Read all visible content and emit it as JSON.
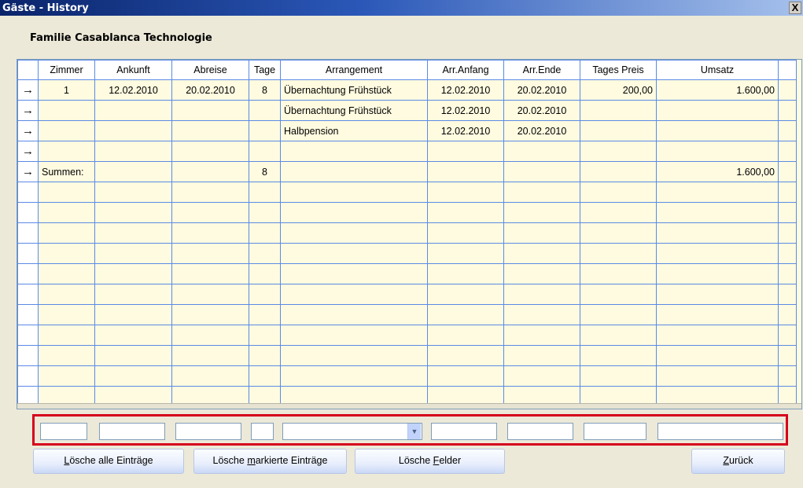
{
  "window": {
    "title": "Gäste - History",
    "close_label": "X"
  },
  "guest_name": "Familie Casablanca Technologie",
  "columns": [
    "Zimmer",
    "Ankunft",
    "Abreise",
    "Tage",
    "Arrangement",
    "Arr.Anfang",
    "Arr.Ende",
    "Tages Preis",
    "Umsatz"
  ],
  "row_marker": "→",
  "rows": [
    {
      "zimmer": "1",
      "ankunft": "12.02.2010",
      "abreise": "20.02.2010",
      "tage": "8",
      "arrangement": "Übernachtung Frühstück",
      "arr_anfang": "12.02.2010",
      "arr_ende": "20.02.2010",
      "tages_preis": "200,00",
      "umsatz": "1.600,00"
    },
    {
      "zimmer": "",
      "ankunft": "",
      "abreise": "",
      "tage": "",
      "arrangement": "Übernachtung Frühstück",
      "arr_anfang": "12.02.2010",
      "arr_ende": "20.02.2010",
      "tages_preis": "",
      "umsatz": ""
    },
    {
      "zimmer": "",
      "ankunft": "",
      "abreise": "",
      "tage": "",
      "arrangement": "Halbpension",
      "arr_anfang": "12.02.2010",
      "arr_ende": "20.02.2010",
      "tages_preis": "",
      "umsatz": ""
    },
    {
      "zimmer": "",
      "ankunft": "",
      "abreise": "",
      "tage": "",
      "arrangement": "",
      "arr_anfang": "",
      "arr_ende": "",
      "tages_preis": "",
      "umsatz": ""
    },
    {
      "zimmer": "Summen:",
      "ankunft": "",
      "abreise": "",
      "tage": "8",
      "arrangement": "",
      "arr_anfang": "",
      "arr_ende": "",
      "tages_preis": "",
      "umsatz": "1.600,00"
    }
  ],
  "filters": {
    "zimmer": "",
    "ankunft": "",
    "abreise": "",
    "tage": "",
    "arrangement": "",
    "arr_anfang": "",
    "arr_ende": "",
    "tages_preis": "",
    "umsatz": ""
  },
  "buttons": {
    "delete_all": {
      "pre": "",
      "accel": "L",
      "post": "ösche alle Einträge"
    },
    "delete_marked": {
      "pre": "Lösche ",
      "accel": "m",
      "post": "arkierte Einträge"
    },
    "delete_fields": {
      "pre": "Lösche ",
      "accel": "F",
      "post": "elder"
    },
    "back": {
      "pre": "",
      "accel": "Z",
      "post": "urück"
    }
  },
  "colors": {
    "grid_bg": "#fffbe0",
    "grid_line": "#5a8ae6",
    "highlight": "#d6001c",
    "titlebar": "#0a246a"
  }
}
